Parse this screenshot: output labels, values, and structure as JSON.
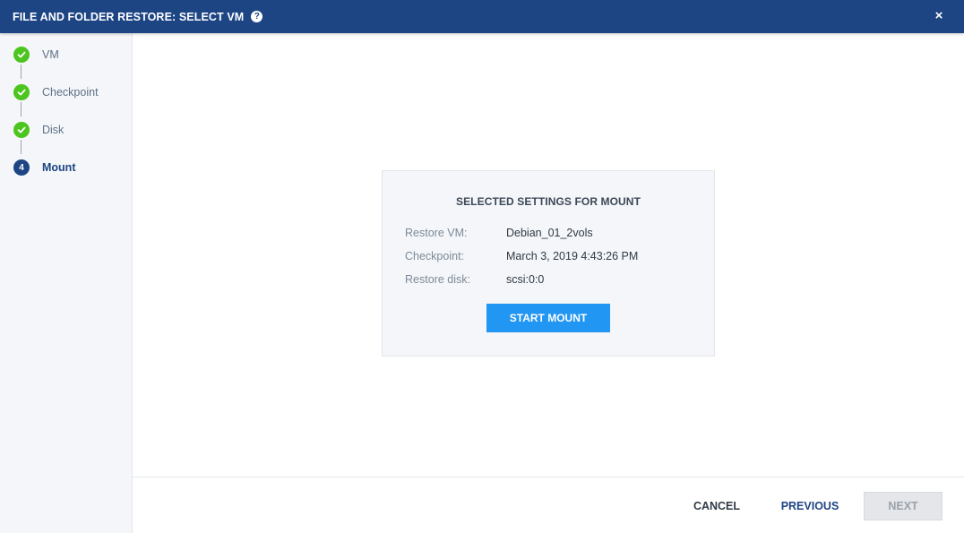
{
  "dialog": {
    "title": "FILE AND FOLDER RESTORE: SELECT VM",
    "help_glyph": "?",
    "close_glyph": "×"
  },
  "steps": [
    {
      "label": "VM",
      "state": "done"
    },
    {
      "label": "Checkpoint",
      "state": "done"
    },
    {
      "label": "Disk",
      "state": "done"
    },
    {
      "label": "Mount",
      "state": "current",
      "number": "4"
    }
  ],
  "summary": {
    "title": "SELECTED SETTINGS FOR MOUNT",
    "rows": [
      {
        "key": "Restore VM:",
        "value": "Debian_01_2vols"
      },
      {
        "key": "Checkpoint:",
        "value": "March 3, 2019 4:43:26 PM"
      },
      {
        "key": "Restore disk:",
        "value": "scsi:0:0"
      }
    ],
    "start_button": "START MOUNT"
  },
  "footer": {
    "cancel": "CANCEL",
    "previous": "PREVIOUS",
    "next": "NEXT",
    "next_disabled": true
  },
  "colors": {
    "header": "#1d4584",
    "step_done": "#4cc51e",
    "primary_button": "#2196f3"
  }
}
